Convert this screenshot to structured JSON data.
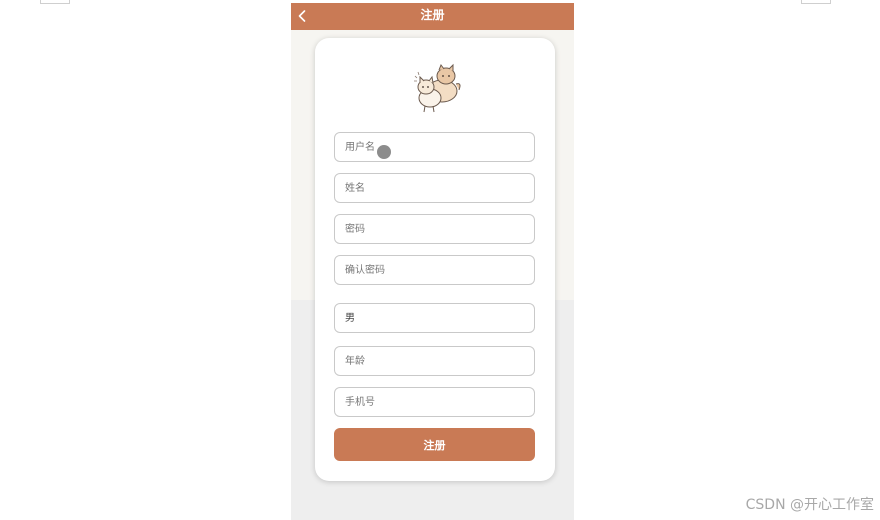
{
  "navbar": {
    "title": "注册",
    "back_icon": "chevron-left-icon",
    "background_color": "#c97a55"
  },
  "avatar": {
    "icon": "shiba-dogs-illustration"
  },
  "form": {
    "username_placeholder": "用户名",
    "name_placeholder": "姓名",
    "password_placeholder": "密码",
    "confirm_password_placeholder": "确认密码",
    "gender_value": "男",
    "age_placeholder": "年龄",
    "phone_placeholder": "手机号",
    "submit_label": "注册"
  },
  "colors": {
    "accent": "#c97a55",
    "page_background": "#eeeeee",
    "card_background": "#ffffff"
  },
  "watermark": "CSDN @开心工作室"
}
